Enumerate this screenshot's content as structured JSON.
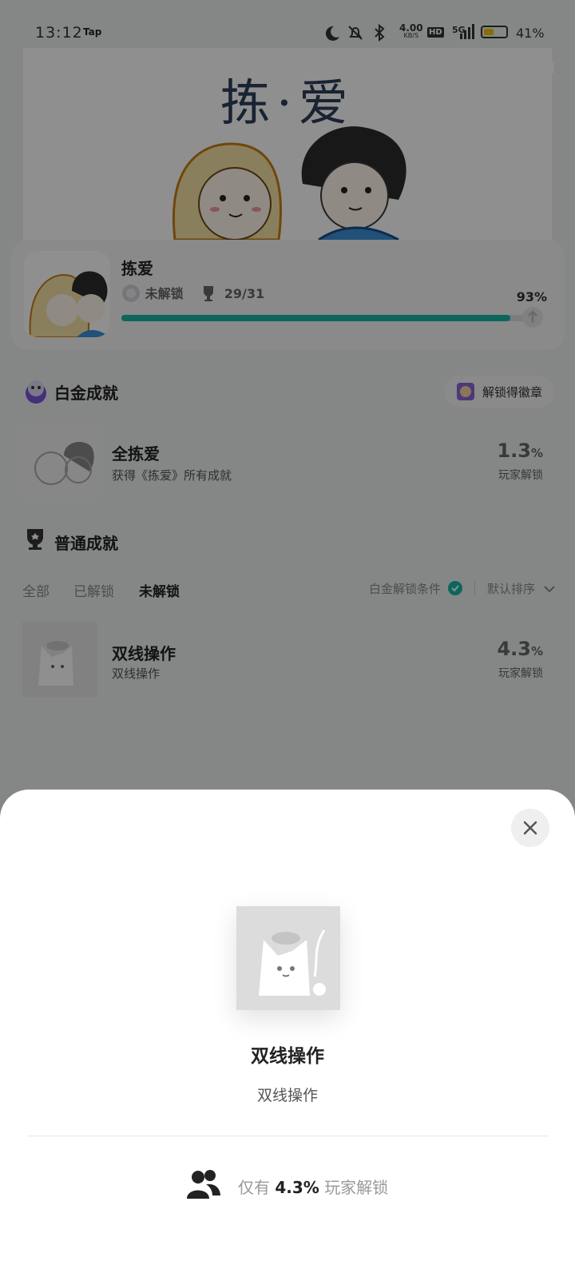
{
  "status_bar": {
    "time": "13:12",
    "app_badge": "Tap",
    "net_speed": "4.00",
    "net_unit": "KB/S",
    "hd": "HD",
    "network": "5G",
    "battery": "41%",
    "battery_color": "#f5c400"
  },
  "hero": {
    "title": "拣·爱"
  },
  "game": {
    "name": "拣爱",
    "unlock_status": "未解锁",
    "trophy_count": "29/31",
    "percent_text": "93%",
    "progress": 0.93,
    "accent": "#17b6a4"
  },
  "platinum": {
    "section_title": "白金成就",
    "badge_button": "解锁得徽章",
    "item": {
      "title": "全拣爱",
      "desc": "获得《拣爱》所有成就",
      "rate": "1.3",
      "rate_unit": "%",
      "rate_label": "玩家解锁"
    }
  },
  "normal": {
    "section_title": "普通成就",
    "filters": [
      "全部",
      "已解锁",
      "未解锁"
    ],
    "active_filter": "未解锁",
    "platinum_condition": "白金解锁条件",
    "sort": "默认排序",
    "items": [
      {
        "title": "双线操作",
        "desc": "双线操作",
        "rate": "4.3",
        "rate_unit": "%",
        "rate_label": "玩家解锁"
      }
    ]
  },
  "sheet": {
    "title": "双线操作",
    "desc": "双线操作",
    "players_prefix": "仅有",
    "players_rate": "4.3%",
    "players_suffix": "玩家解锁"
  }
}
